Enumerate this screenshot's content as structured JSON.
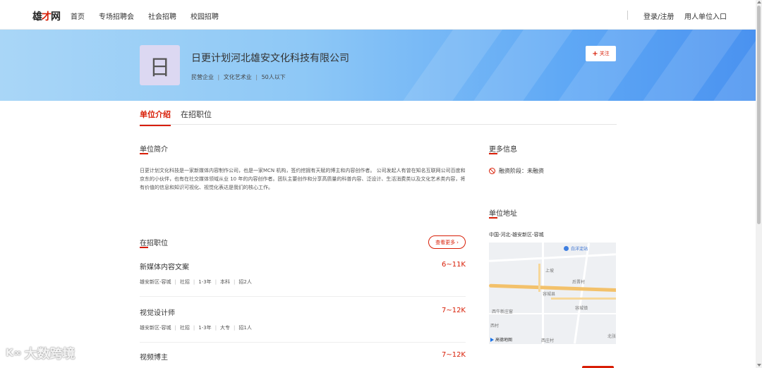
{
  "header": {
    "logo_a": "雄",
    "logo_b": "才",
    "logo_c": "网",
    "nav": [
      "首页",
      "专场招聘会",
      "社会招聘",
      "校园招聘"
    ],
    "login": "登录/注册",
    "employer_entry": "用人单位入口"
  },
  "company": {
    "logo_char": "日",
    "name": "日更计划河北雄安文化科技有限公司",
    "type": "民营企业",
    "industry": "文化艺术业",
    "size": "50人以下",
    "follow": "关注",
    "follow_plus": "+"
  },
  "tabs": [
    "单位介绍",
    "在招职位"
  ],
  "intro": {
    "title": "单位简介",
    "text": "日更计划文化科技是一家新媒体内容制作公司，也是一家MCN 机构，签约挖掘有天赋的博主和内容创作者。 公司发起人有曾在知名互联网公司百度和京东的小伙伴，也有在社交媒体领域从业 10 年的内容创作者。团队主要创作和分享高质量的科普内容、泛设计、生活消费类以及文化艺术类内容，将有价值的信息和知识可视化、视觉化表达是我们的核心工作。"
  },
  "jobs_section": {
    "title": "在招职位",
    "more": "查看更多",
    "more_arrow": "›",
    "jobs": [
      {
        "title": "新媒体内容文案",
        "salary": "6~11K",
        "location": "雄安新区-容城",
        "kind": "社招",
        "exp": "1-3年",
        "edu": "本科",
        "count": "招2人"
      },
      {
        "title": "视觉设计师",
        "salary": "7~12K",
        "location": "雄安新区-容城",
        "kind": "社招",
        "exp": "1-3年",
        "edu": "大专",
        "count": "招1人"
      },
      {
        "title": "视频博主",
        "salary": "7~12K"
      }
    ]
  },
  "more_info": {
    "title": "更多信息",
    "financing": "融资阶段：未融资"
  },
  "address": {
    "title": "单位地址",
    "text": "中国-河北-雄安新区-容城",
    "map_labels": [
      "白洋淀站",
      "上坡",
      "后晋村",
      "容城县",
      "容城镇",
      "西牛新庄窗",
      "西村",
      "西庄村",
      "北张"
    ],
    "map_brand": "高德地图"
  },
  "watermark": "大数跨境",
  "watermark_logo": "K∞"
}
